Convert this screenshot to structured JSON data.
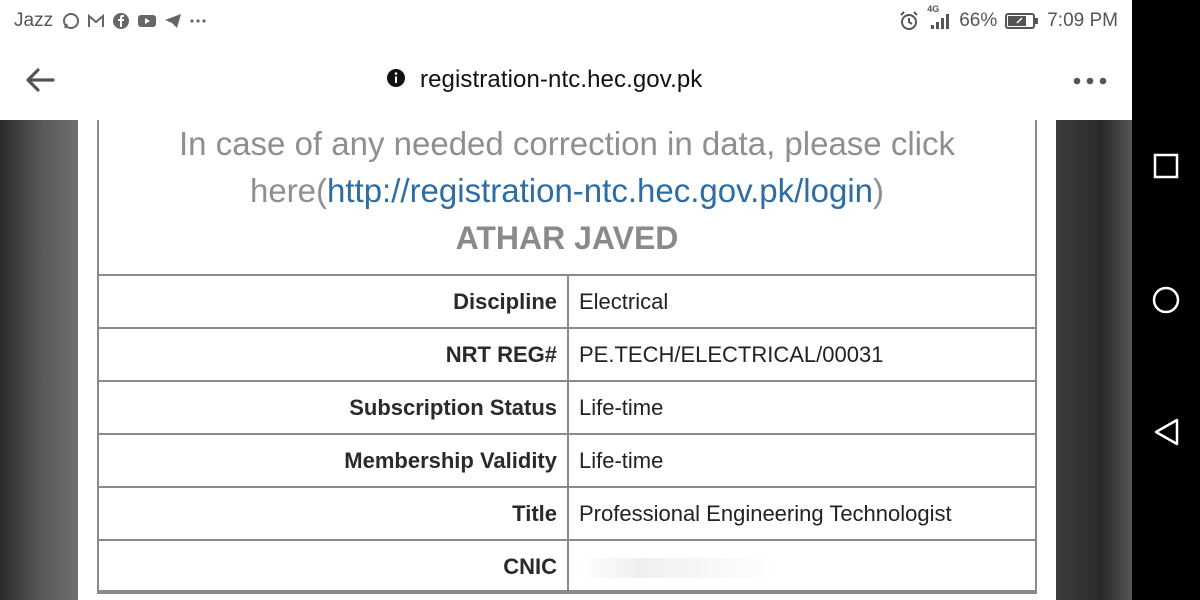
{
  "status_bar": {
    "carrier": "Jazz",
    "notification_icons": [
      "whatsapp-icon",
      "gmail-icon",
      "facebook-icon",
      "youtube-icon",
      "telegram-icon",
      "more-notifications-icon"
    ],
    "network_type": "4G",
    "battery": "66%",
    "time": "7:09 PM"
  },
  "browser": {
    "url": "registration-ntc.hec.gov.pk"
  },
  "page": {
    "notice_text": "In case of any needed correction in data, please click here(",
    "notice_link": "http://registration-ntc.hec.gov.pk/login",
    "notice_close": ")",
    "name": "ATHAR JAVED",
    "rows": [
      {
        "label": "Discipline",
        "value": "Electrical"
      },
      {
        "label": "NRT REG#",
        "value": "PE.TECH/ELECTRICAL/00031"
      },
      {
        "label": "Subscription Status",
        "value": "Life-time"
      },
      {
        "label": "Membership Validity",
        "value": "Life-time"
      },
      {
        "label": "Title",
        "value": "Professional Engineering Technologist"
      },
      {
        "label": "CNIC",
        "value": ""
      }
    ]
  },
  "colors": {
    "link": "#2e6da4",
    "notice_text": "#8f8f8f",
    "nav_bar": "#000000"
  }
}
